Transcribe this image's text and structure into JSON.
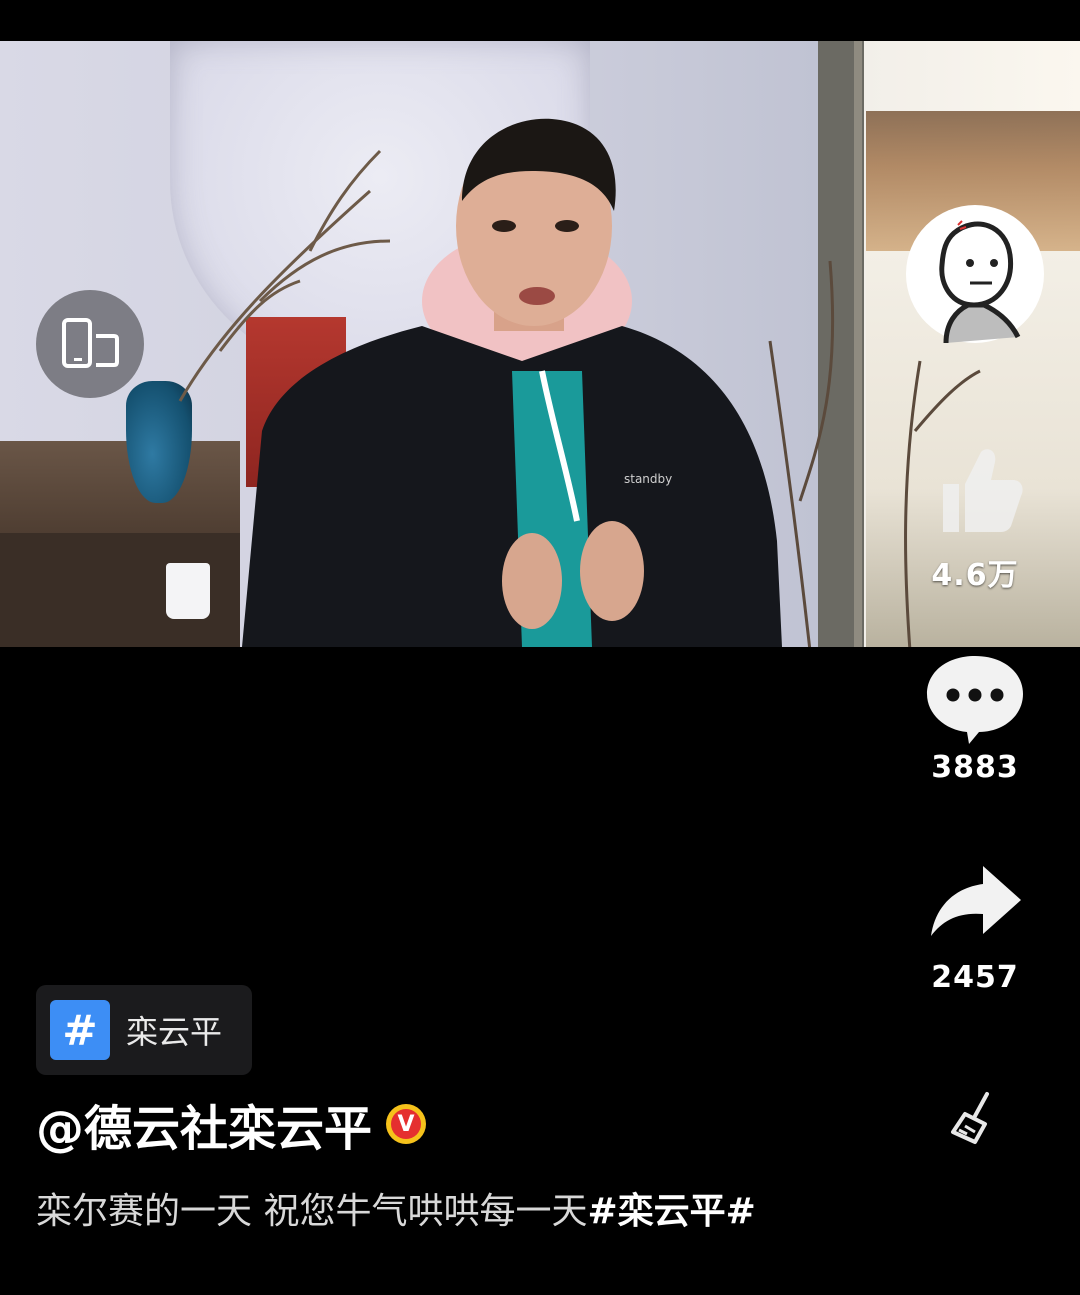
{
  "actions": {
    "like_count": "4.6万",
    "comment_count": "3883",
    "share_count": "2457"
  },
  "topic": {
    "label": "栾云平"
  },
  "author": {
    "handle": "@德云社栾云平",
    "verified_mark": "V"
  },
  "caption": {
    "text": "栾尔赛的一天 祝您牛气哄哄每一天",
    "hashtag": "#栾云平#"
  },
  "icons": {
    "rotate": "rotate-screen-icon",
    "like": "thumbs-up-icon",
    "comment": "comment-bubble-icon",
    "share": "share-arrow-icon",
    "clear": "broom-clear-icon"
  },
  "colors": {
    "background": "#000000",
    "topic_badge": "#3d8ef5",
    "verified_outer": "#f6c21b",
    "verified_inner": "#e52f2f"
  }
}
